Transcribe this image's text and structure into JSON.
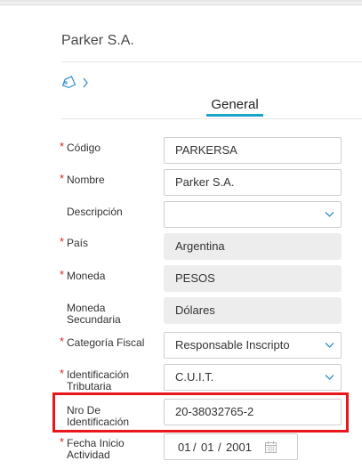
{
  "header": {
    "company": "Parker S.A."
  },
  "tabs": [
    {
      "label": "General",
      "active": true
    }
  ],
  "colors": {
    "required": "#d12a2a",
    "accent": "#1aa3c9",
    "highlight": "#e8171c"
  },
  "fields": {
    "codigo": {
      "label": "Código",
      "required": true,
      "value": "PARKERSA"
    },
    "nombre": {
      "label": "Nombre",
      "required": true,
      "value": "Parker S.A."
    },
    "descripcion": {
      "label": "Descripción",
      "required": false,
      "value": ""
    },
    "pais": {
      "label": "País",
      "required": true,
      "value": "Argentina"
    },
    "moneda": {
      "label": "Moneda",
      "required": true,
      "value": "PESOS"
    },
    "moneda_secundaria": {
      "label1": "Moneda",
      "label2": "Secundaria",
      "required": false,
      "value": "Dólares"
    },
    "categoria_fiscal": {
      "label": "Categoría Fiscal",
      "required": true,
      "value": "Responsable Inscripto"
    },
    "identificacion_tributaria": {
      "label1": "Identificación",
      "label2": "Tributaria",
      "required": true,
      "value": "C.U.I.T."
    },
    "nro_identificacion": {
      "label1": "Nro De",
      "label2": "Identificación",
      "required": false,
      "value": "20-38032765-2"
    },
    "fecha_inicio": {
      "label1": "Fecha Inicio",
      "label2": "Actividad",
      "required": true,
      "day": "01",
      "month": "01",
      "year": "2001",
      "sep": "/"
    }
  },
  "required_mark": "*"
}
